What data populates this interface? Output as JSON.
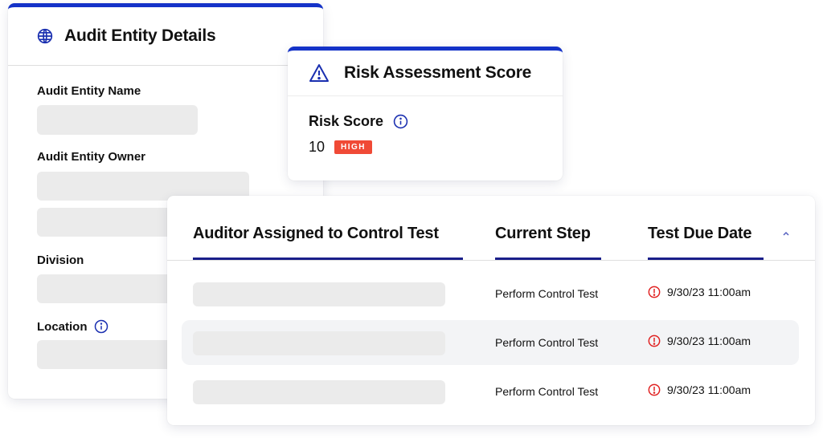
{
  "entity_card": {
    "title": "Audit Entity Details",
    "icon": "globe-icon",
    "fields": [
      {
        "label": "Audit Entity Name"
      },
      {
        "label": "Audit Entity Owner"
      },
      {
        "label": "Division"
      },
      {
        "label": "Location",
        "info_icon": true
      }
    ]
  },
  "risk_card": {
    "title": "Risk Assessment Score",
    "icon": "warning-triangle-icon",
    "label": "Risk Score",
    "score": "10",
    "badge": "HIGH",
    "badge_color": "#f04a36"
  },
  "table": {
    "columns": [
      "Auditor Assigned to Control Test",
      "Current Step",
      "Test Due Date"
    ],
    "sort_icon": "chevron-up-icon",
    "rows": [
      {
        "auditor": "",
        "step": "Perform Control Test",
        "due": "9/30/23 11:00am",
        "overdue": true
      },
      {
        "auditor": "",
        "step": "Perform Control Test",
        "due": "9/30/23 11:00am",
        "overdue": true
      },
      {
        "auditor": "",
        "step": "Perform Control Test",
        "due": "9/30/23 11:00am",
        "overdue": true
      }
    ]
  },
  "colors": {
    "accent": "#1432c8",
    "underline": "#1a1f8a",
    "alert": "#e02020"
  }
}
